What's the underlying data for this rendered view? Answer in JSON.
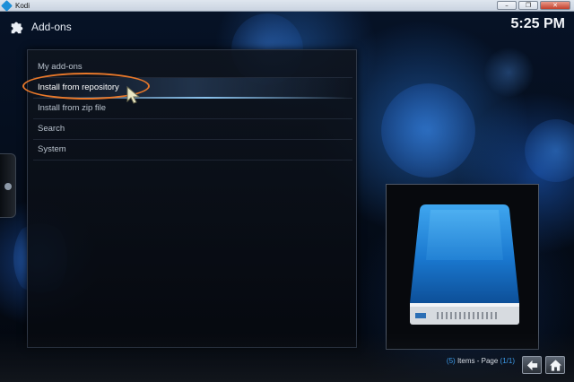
{
  "window": {
    "title": "Kodi",
    "buttons": [
      "–",
      "❐",
      "✕"
    ]
  },
  "header": {
    "title": "Add-ons",
    "icon": "puzzle-icon",
    "clock": "5:25 PM"
  },
  "menu": {
    "items": [
      {
        "label": "My add-ons"
      },
      {
        "label": "Install from repository"
      },
      {
        "label": "Install from zip file"
      },
      {
        "label": "Search"
      },
      {
        "label": "System"
      }
    ],
    "focused_index": 1
  },
  "thumbnail": {
    "icon": "hard-drive-icon"
  },
  "footer": {
    "count": "5",
    "items_text": "Items - Page",
    "page": "1/1",
    "back_icon": "back-arrow-icon",
    "home_icon": "home-icon"
  },
  "colors": {
    "accent_blue": "#3d9ae8",
    "highlight_orange": "#e8782a"
  }
}
